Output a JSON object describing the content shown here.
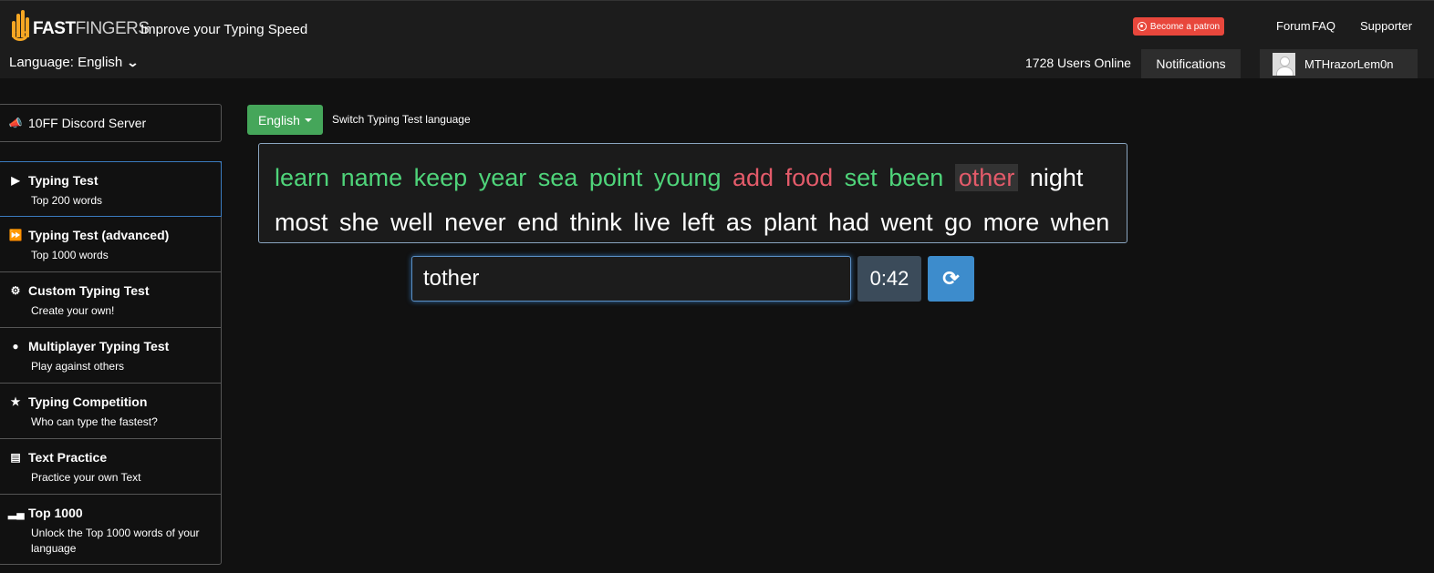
{
  "header": {
    "logo_fast": "FAST",
    "logo_fingers": "FINGERS",
    "tagline": "Improve your Typing Speed",
    "language_label": "Language: English",
    "patron_label": "Become a patron",
    "links": [
      "Forum",
      "FAQ",
      "Supporter"
    ],
    "users_online": "1728 Users Online",
    "notifications_label": "Notifications",
    "username": "MTHrazorLem0n"
  },
  "sidebar": {
    "discord_label": "10FF Discord Server",
    "items": [
      {
        "title": "Typing Test",
        "sub": "Top 200 words",
        "icon": "play-icon"
      },
      {
        "title": "Typing Test (advanced)",
        "sub": "Top 1000 words",
        "icon": "fast-forward-icon"
      },
      {
        "title": "Custom Typing Test",
        "sub": "Create your own!",
        "icon": "gears-icon"
      },
      {
        "title": "Multiplayer Typing Test",
        "sub": "Play against others",
        "icon": "users-icon"
      },
      {
        "title": "Typing Competition",
        "sub": "Who can type the fastest?",
        "icon": "trophy-icon"
      },
      {
        "title": "Text Practice",
        "sub": "Practice your own Text",
        "icon": "document-icon"
      },
      {
        "title": "Top 1000",
        "sub": "Unlock the Top 1000 words of your language",
        "icon": "signal-icon"
      }
    ]
  },
  "test": {
    "language_button": "English",
    "switch_label": "Switch Typing Test language",
    "words": {
      "correct": [
        "learn",
        "name",
        "keep",
        "year",
        "sea",
        "point",
        "young"
      ],
      "wrong": [
        "add",
        "food"
      ],
      "correct_after": [
        "set",
        "been"
      ],
      "current": "other",
      "pending_line1": [
        "night"
      ],
      "pending_line2": [
        "most",
        "she",
        "well",
        "never",
        "end",
        "think",
        "live",
        "left",
        "as",
        "plant",
        "had",
        "went",
        "go",
        "more",
        "when"
      ]
    },
    "input_value": "tother",
    "timer": "0:42"
  },
  "colors": {
    "correct": "#4fd47a",
    "wrong": "#e35b6a",
    "accent_green": "#45a65a",
    "accent_blue": "#3d8ccc"
  }
}
